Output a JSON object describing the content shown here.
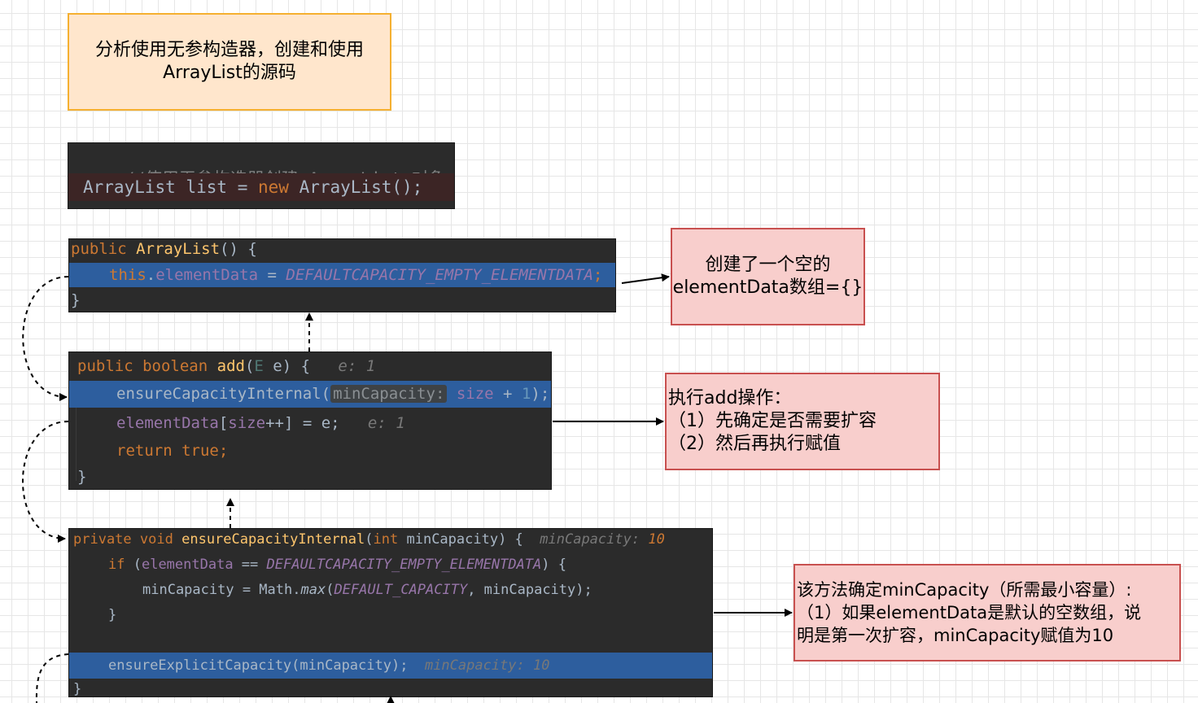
{
  "title_note": {
    "line1": "分析使用无参构造器，创建和使用",
    "line2": "ArrayList的源码"
  },
  "snippet_create": {
    "comment": "//使用无参构造器创建 ArrayList 对象",
    "type": "ArrayList",
    "var": "list",
    "op": "=",
    "new_kw": "new",
    "ctor": "ArrayList();"
  },
  "ctor_block": {
    "line1_kw": "public",
    "line1_name": "ArrayList",
    "line1_rest": "() {",
    "line2_this": "this",
    "line2_dot": ".",
    "line2_field": "elementData",
    "line2_eq": " = ",
    "line2_const": "DEFAULTCAPACITY_EMPTY_ELEMENTDATA",
    "line2_semi": ";",
    "line3": "}"
  },
  "ctor_note": {
    "line1": "创建了一个空的",
    "line2": "elementData数组={}"
  },
  "add_block": {
    "line1_kw1": "public",
    "line1_kw2": "boolean",
    "line1_name": "add",
    "line1_params_open": "(",
    "line1_params_type": "E",
    "line1_params_rest": " e) {",
    "line1_hint": "e: 1",
    "line2_call": "ensureCapacityInternal(",
    "line2_param_hint": "minCapacity:",
    "line2_field": "size",
    "line2_op": " + ",
    "line2_num": "1",
    "line2_close": ");",
    "line3_field": "elementData",
    "line3_open": "[",
    "line3_field2": "size",
    "line3_rest": "++] = e;",
    "line3_hint": "e: 1",
    "line4_kw1": "return",
    "line4_kw2": "true",
    "line4_semi": ";",
    "line5": "}"
  },
  "add_note": {
    "line1": "执行add操作：",
    "line2": "（1）先确定是否需要扩容",
    "line3": "（2）然后再执行赋值"
  },
  "eci_block": {
    "line1_kw1": "private",
    "line1_kw2": "void",
    "line1_name": "ensureCapacityInternal",
    "line1_open": "(",
    "line1_kw3": "int",
    "line1_rest": " minCapacity) {",
    "line1_hint_label": "minCapacity: ",
    "line1_hint_value": "10",
    "line2_kw": "if",
    "line2_open": " (",
    "line2_field": "elementData",
    "line2_op": " == ",
    "line2_const": "DEFAULTCAPACITY_EMPTY_ELEMENTDATA",
    "line2_close": ") {",
    "line3_lhs": "minCapacity = Math.",
    "line3_fn": "max",
    "line3_open": "(",
    "line3_const": "DEFAULT_CAPACITY",
    "line3_rest": ", minCapacity);",
    "line4": "}",
    "line6_call": "ensureExplicitCapacity(minCapacity);",
    "line6_hint": "minCapacity: 10",
    "line7": "}"
  },
  "eci_note": {
    "line1": "该方法确定minCapacity（所需最小容量）:",
    "line2": "（1）如果elementData是默认的空数组，说",
    "line3": "明是第一次扩容，minCapacity赋值为10"
  }
}
